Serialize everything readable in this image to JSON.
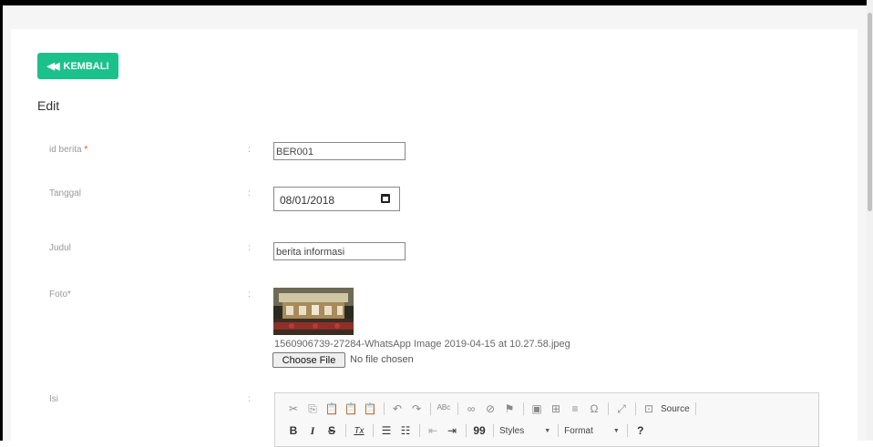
{
  "back_button": {
    "label": "KEMBALI",
    "icon": "double-chevron-left-icon"
  },
  "form_title": "Edit",
  "fields": {
    "id_berita": {
      "label": "id berita",
      "required_mark": "*",
      "value": "BER001"
    },
    "tanggal": {
      "label": "Tanggal",
      "value": "08/01/2018"
    },
    "judul": {
      "label": "Judul",
      "value": "berita informasi"
    },
    "foto": {
      "label": "Foto*",
      "filename": "1560906739-27284-WhatsApp Image 2019-04-15 at 10.27.58.jpeg",
      "choose_label": "Choose File",
      "no_file": "No file chosen"
    },
    "isi": {
      "label": "Isi"
    }
  },
  "colon": ":",
  "editor": {
    "source_label": "Source",
    "styles_label": "Styles",
    "format_label": "Format",
    "help_label": "?",
    "bold": "B",
    "italic": "I",
    "strike": "S",
    "remove_format": "Tx",
    "blockquote": "99"
  },
  "colors": {
    "accent": "#1bc18a",
    "required": "#e74c3c"
  }
}
